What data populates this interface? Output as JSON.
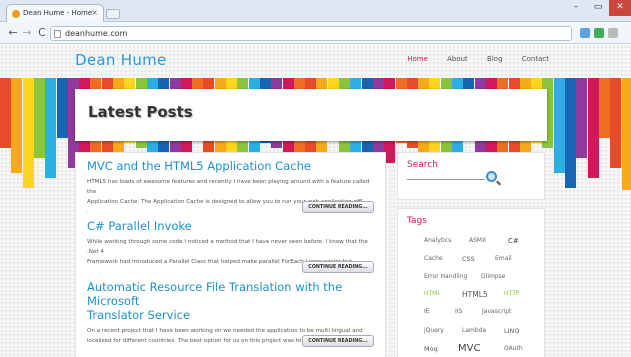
{
  "browser": {
    "tab_title": "Dean Hume - Home",
    "tab_close": "×",
    "url": "deanhume.com",
    "window_controls": [
      "–",
      "▭",
      "✕"
    ],
    "nav_buttons": [
      "←",
      "→",
      "C"
    ],
    "bookmark_star": "☆"
  },
  "site": {
    "logo": "Dean Hume",
    "menu": [
      "Home",
      "About",
      "Blog",
      "Contact"
    ],
    "active_menu": "Home",
    "hero_title": "Latest Posts"
  },
  "posts": [
    {
      "title": "MVC and the HTML5 Application Cache",
      "excerpt_lines": [
        "HTML5 has loads of awesome features and recently I have been playing around with a feature called the",
        "Application Cache. The Application Cache is designed to allow you to run your web application offl . . . . ."
      ],
      "button": "CONTINUE READING..."
    },
    {
      "title": "C# Parallel Invoke",
      "excerpt_lines": [
        "While working through some code I noticed a method that I have never seen before. I know that the .Net 4",
        "Framework had introduced a Parallel Class that helped make parallel ForEach Loops easier but . . . . ."
      ],
      "button": "CONTINUE READING..."
    },
    {
      "title_lines": [
        "Automatic Resource File Translation with the Microsoft",
        "Translator Service"
      ],
      "excerpt_lines": [
        "On a recent project that I have been working on we needed the application to be multi lingual and",
        "localized for different countries. The best option for us on this project was to use resource files ( . . . . ."
      ],
      "button": "CONTINUE READING..."
    }
  ],
  "sidebar": {
    "search_title": "Search",
    "tags_title": "Tags",
    "tags": [
      "Analytics",
      "ASMX",
      "C#",
      "Cache",
      "CSS",
      "Email",
      "Error Handling",
      "Glimpse",
      "HTML",
      "HTML5",
      "HTTP",
      "IE",
      "IIS",
      "Javascript",
      "jQuery",
      "Lambda",
      "LINQ",
      "Moq",
      "MVC",
      "OAuth"
    ]
  },
  "colors": {
    "accent": "#d0185b",
    "link": "#1f8fcc",
    "stripes": [
      "#e74c2a",
      "#f7a81b",
      "#ffd51f",
      "#8bc43f",
      "#2cb0e4",
      "#1765b3",
      "#8e3b9b",
      "#d0185b",
      "#f06e23"
    ]
  }
}
